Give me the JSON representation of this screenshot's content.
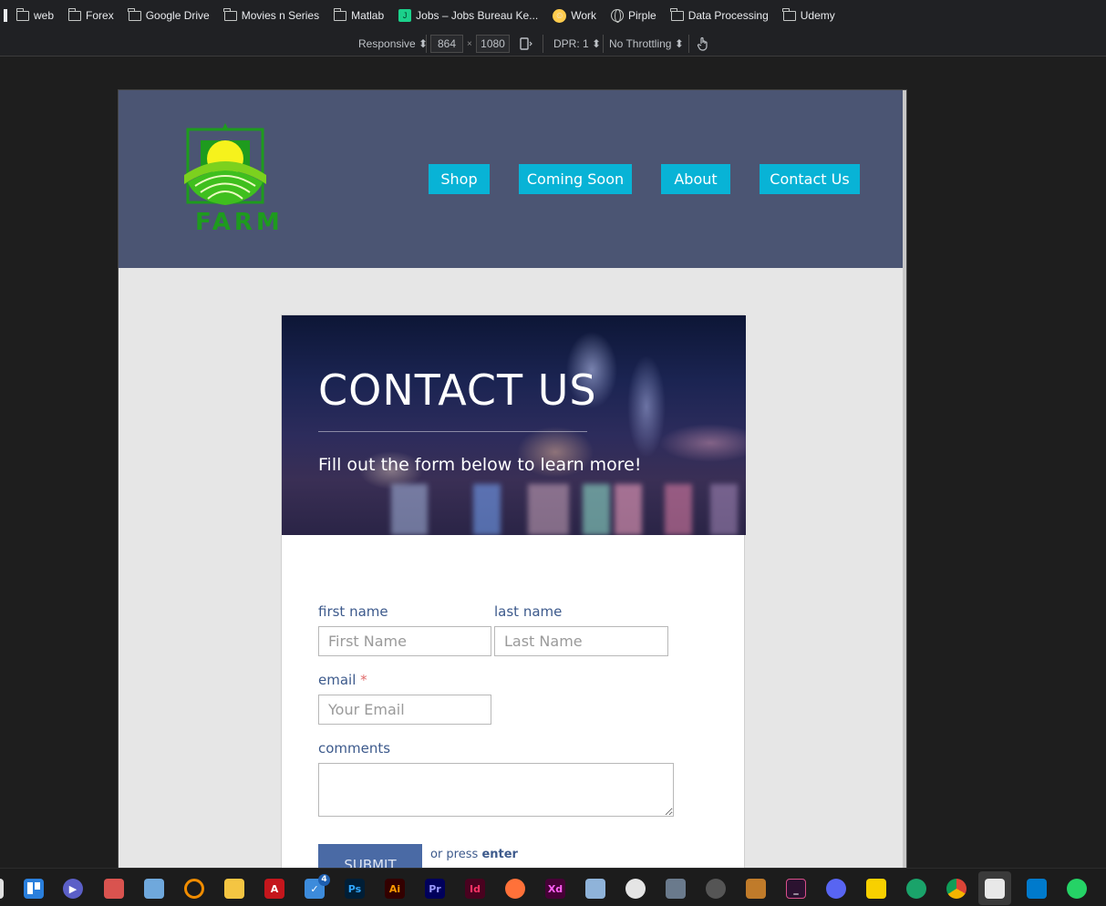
{
  "bookmarks": [
    {
      "label": "web",
      "icon": "folder-icon"
    },
    {
      "label": "Forex",
      "icon": "folder-icon"
    },
    {
      "label": "Google Drive",
      "icon": "folder-icon"
    },
    {
      "label": "Movies n Series",
      "icon": "folder-icon"
    },
    {
      "label": "Matlab",
      "icon": "folder-icon"
    },
    {
      "label": "Jobs – Jobs Bureau Ke...",
      "icon": "jobs-icon"
    },
    {
      "label": "Work",
      "icon": "emoji-icon"
    },
    {
      "label": "Pirple",
      "icon": "globe-icon"
    },
    {
      "label": "Data Processing",
      "icon": "folder-icon"
    },
    {
      "label": "Udemy",
      "icon": "folder-icon"
    }
  ],
  "devtools": {
    "device": "Responsive ⬍",
    "width": "864",
    "times": "×",
    "height": "1080",
    "dpr": "DPR: 1 ⬍",
    "throttle": "No Throttling ⬍"
  },
  "site": {
    "logo_text": "FARM",
    "nav": [
      "Shop",
      "Coming Soon",
      "About",
      "Contact Us"
    ],
    "hero_title": "CONTACT US",
    "hero_subtitle": "Fill out the form below to learn more!",
    "form": {
      "first_name_label": "first name",
      "first_name_placeholder": "First Name",
      "last_name_label": "last name",
      "last_name_placeholder": "Last Name",
      "email_label": "email",
      "email_required": "*",
      "email_placeholder": "Your Email",
      "comments_label": "comments",
      "submit_label": "SUBMIT",
      "press_prefix": "or press",
      "press_key": "enter"
    }
  },
  "taskbar": {
    "icons": [
      "start-icon",
      "trello-icon",
      "teams-icon",
      "box-icon",
      "cloud-icon",
      "search-icon",
      "explorer-icon",
      "acrobat-icon",
      "todo-icon",
      "photoshop-icon",
      "illustrator-icon",
      "premiere-icon",
      "indesign-icon",
      "firefox-icon",
      "xd-icon",
      "resource-monitor-icon",
      "slack-icon",
      "calculator-icon",
      "camera-icon",
      "game-icon",
      "terminal-icon",
      "discord-icon",
      "sticky-notes-icon",
      "network-icon",
      "chrome-icon",
      "snipping-icon",
      "vscode-icon",
      "whatsapp-icon"
    ],
    "todo_badge": "4",
    "labels": {
      "photoshop": "Ps",
      "illustrator": "Ai",
      "premiere": "Pr",
      "indesign": "Id",
      "xd": "Xd"
    }
  },
  "colors": {
    "header_bg": "#4b5573",
    "nav_button": "#08b3d6",
    "label_text": "#3d5a8c",
    "submit_bg": "#4a6aa5",
    "logo_green": "#1e9b1e"
  }
}
